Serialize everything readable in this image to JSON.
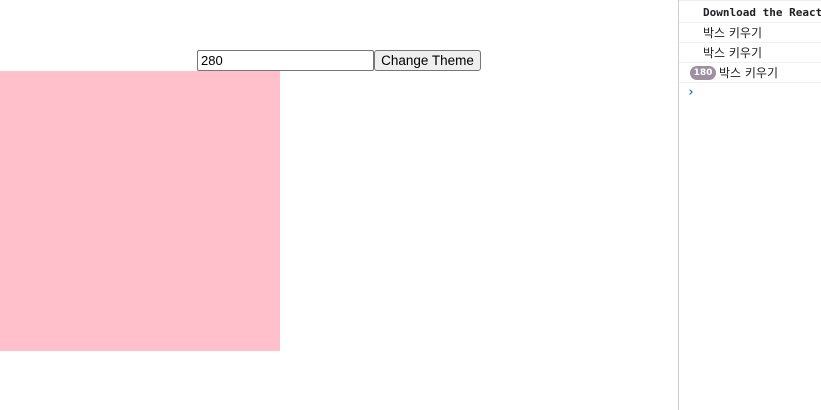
{
  "app": {
    "size_input_value": "280",
    "theme_button_label": "Change Theme",
    "box_color": "#ffc0cb"
  },
  "console": {
    "messages": [
      {
        "text": "Download the React DevTools for a better development experience",
        "repeat": null
      },
      {
        "text": "박스 키우기",
        "repeat": null
      },
      {
        "text": "박스 키우기",
        "repeat": null
      },
      {
        "text": "박스 키우기",
        "repeat": "180"
      }
    ],
    "prompt_icon": "›"
  },
  "colors": {
    "badge": "#9e8fa2",
    "prompt": "#1a73e8",
    "devtools_border": "#cbcdd1"
  }
}
